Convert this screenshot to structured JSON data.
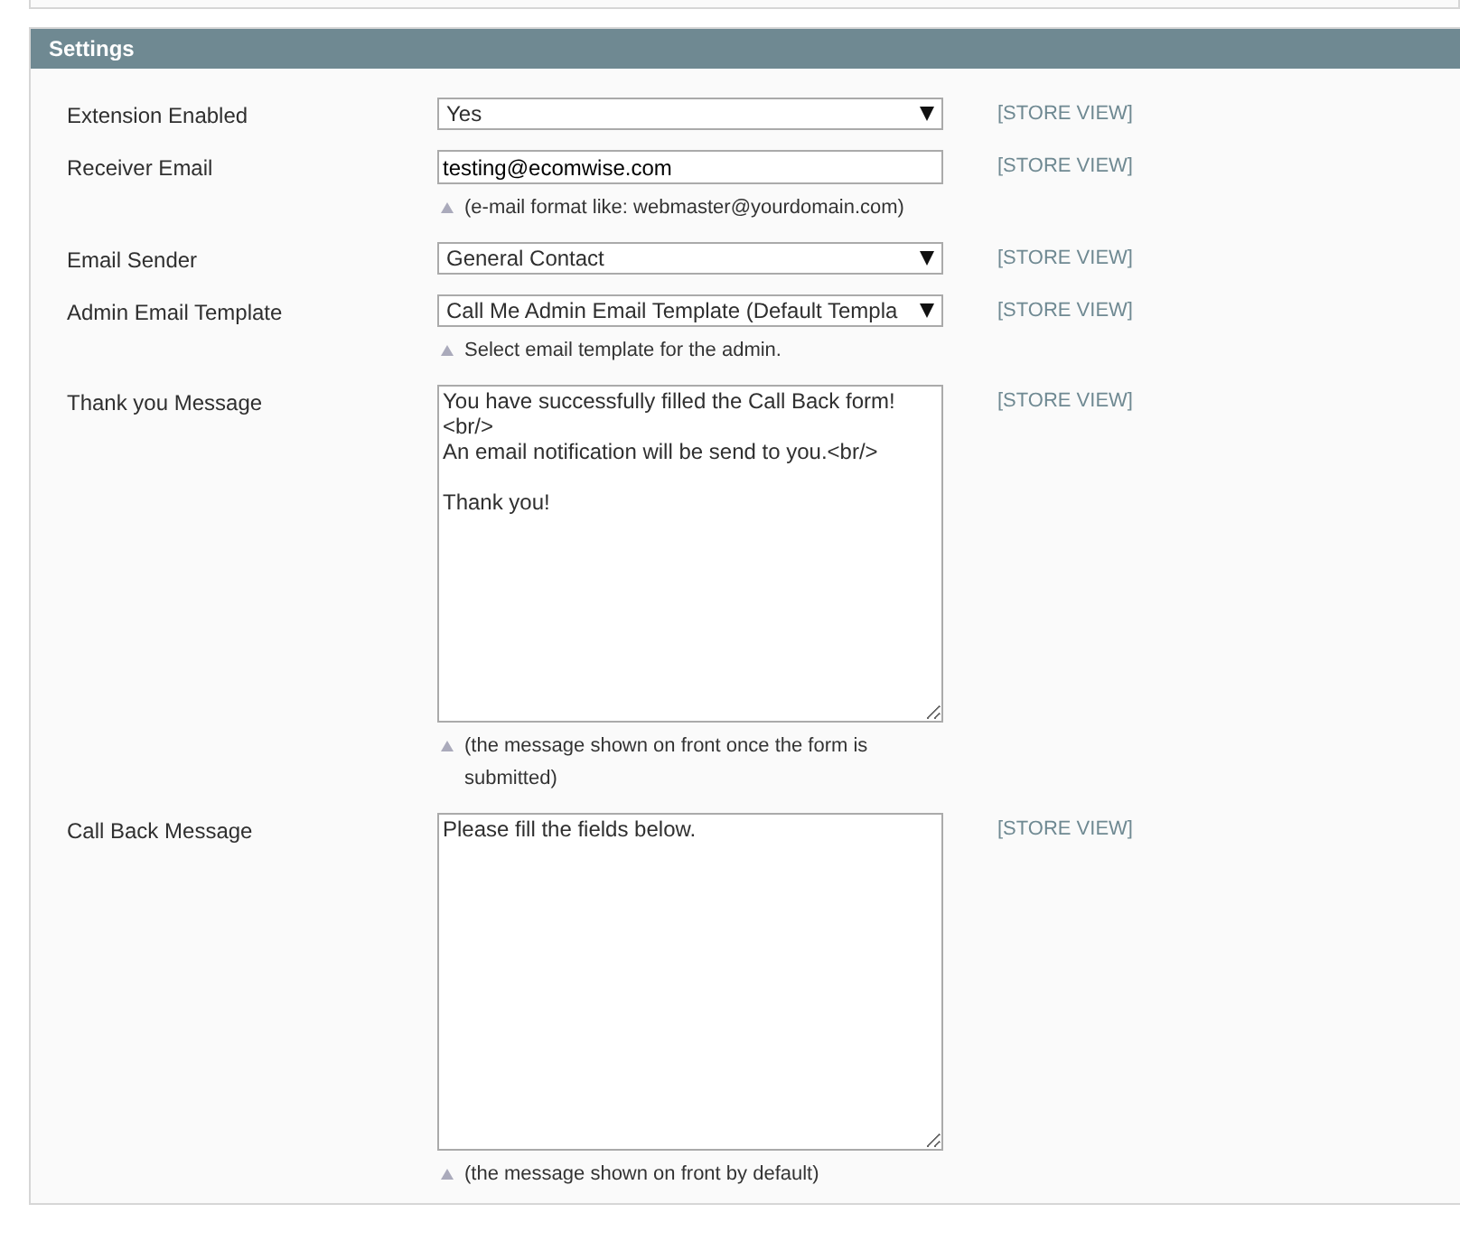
{
  "panel": {
    "title": "Settings"
  },
  "fields": [
    {
      "label": "Extension Enabled",
      "kind": "select",
      "value": "Yes",
      "scope": "[STORE VIEW]"
    },
    {
      "label": "Receiver Email",
      "kind": "text",
      "value": "testing@ecomwise.com",
      "hint": "(e-mail format like: webmaster@yourdomain.com)",
      "scope": "[STORE VIEW]"
    },
    {
      "label": "Email Sender",
      "kind": "select",
      "value": "General Contact",
      "scope": "[STORE VIEW]"
    },
    {
      "label": "Admin Email Template",
      "kind": "select",
      "value": "Call Me Admin Email Template (Default Templa",
      "hint": "Select email template for the admin.",
      "scope": "[STORE VIEW]"
    },
    {
      "label": "Thank you Message",
      "kind": "textarea",
      "value": "You have successfully filled the Call Back form!\n<br/>\nAn email notification will be send to you.<br/>\n\nThank you!",
      "hint": "(the message shown on front once the form is submitted)",
      "scope": "[STORE VIEW]"
    },
    {
      "label": "Call Back Message",
      "kind": "textarea",
      "value": "Please fill the fields below.",
      "hint": "(the message shown on front by default)",
      "scope": "[STORE VIEW]"
    }
  ]
}
